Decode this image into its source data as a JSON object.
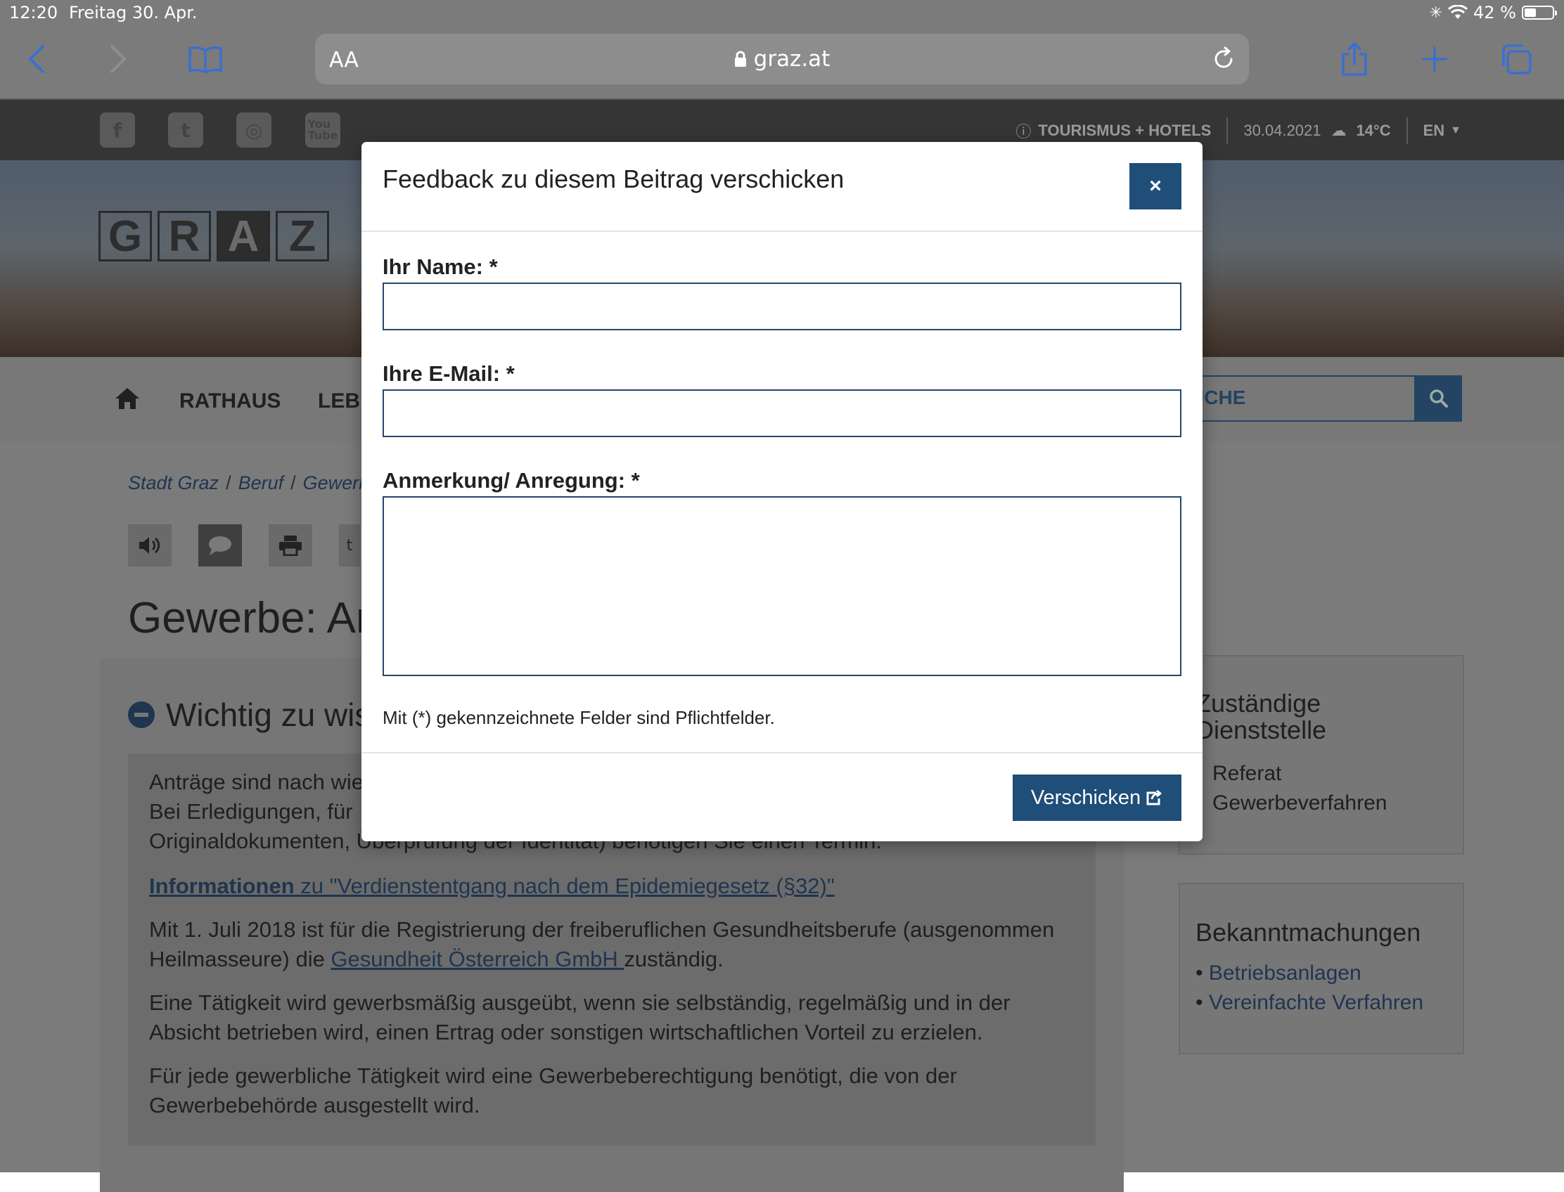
{
  "status_bar": {
    "time": "12:20",
    "date": "Freitag 30. Apr.",
    "battery": "42 %",
    "battery_level": 0.42
  },
  "browser": {
    "text_size_label": "AA",
    "host": "graz.at"
  },
  "topbar": {
    "tourism_link": "TOURISMUS + HOTELS",
    "date": "30.04.2021",
    "temperature": "14°C",
    "language": "EN"
  },
  "social": [
    "facebook-icon",
    "twitter-icon",
    "instagram-icon",
    "youtube-icon"
  ],
  "logo": [
    "G",
    "R",
    "A",
    "Z"
  ],
  "nav": {
    "item1": "RATHAUS",
    "item2": "LEBE",
    "search_placeholder": "UCHE"
  },
  "breadcrumb": [
    "Stadt Graz",
    "Beruf",
    "Gewerb"
  ],
  "page": {
    "title": "Gewerbe: An",
    "section_title": "Wichtig zu wis",
    "para1_line1": "Anträge sind nach wie",
    "para1_line2": "Bei Erledigungen, für",
    "para1_line3": "Originaldokumenten, Überprüfung der Identität) benötigen Sie einen Termin.",
    "info_link_bold": "Informationen",
    "info_link_rest": " zu \"Verdienstentgang nach dem Epidemiegesetz (§32)\"",
    "para2_pre": "Mit 1. Juli 2018 ist für die Registrierung der freiberuflichen Gesundheitsberufe (ausgenommen Heilmasseure) die ",
    "para2_link": "Gesundheit Österreich GmbH ",
    "para2_post": "zuständig.",
    "para3": "Eine Tätigkeit wird gewerbsmäßig ausgeübt, wenn sie selbständig, regelmäßig und in der Absicht betrieben wird, einen Ertrag oder sonstigen wirtschaftlichen Vorteil zu erzielen.",
    "para4": "Für jede gewerbliche Tätigkeit wird eine Gewerbeberechtigung benötigt, die von der Gewerbebehörde ausgestellt wird."
  },
  "sidebar": {
    "box1_title_line1": "Zuständige",
    "box1_title_line2": "Dienststelle",
    "box1_line1": "Referat",
    "box1_line2": "Gewerbeverfahren",
    "box2_title": "Bekanntmachungen",
    "box2_links": [
      "Betriebsanlagen",
      "Vereinfachte Verfahren"
    ]
  },
  "modal": {
    "title": "Feedback zu diesem Beitrag verschicken",
    "close_label": "×",
    "name_label": "Ihr Name: *",
    "name_value": "",
    "email_label": "Ihre E-Mail: *",
    "email_value": "",
    "comment_label": "Anmerkung/ Anregung: *",
    "comment_value": "",
    "hint": "Mit (*) gekennzeichnete Felder sind Pflichtfelder.",
    "submit_label": "Verschicken"
  },
  "colors": {
    "accent": "#1f4e79",
    "dim_overlay": "#7b7b7b",
    "navy_text": "#1f3550"
  }
}
